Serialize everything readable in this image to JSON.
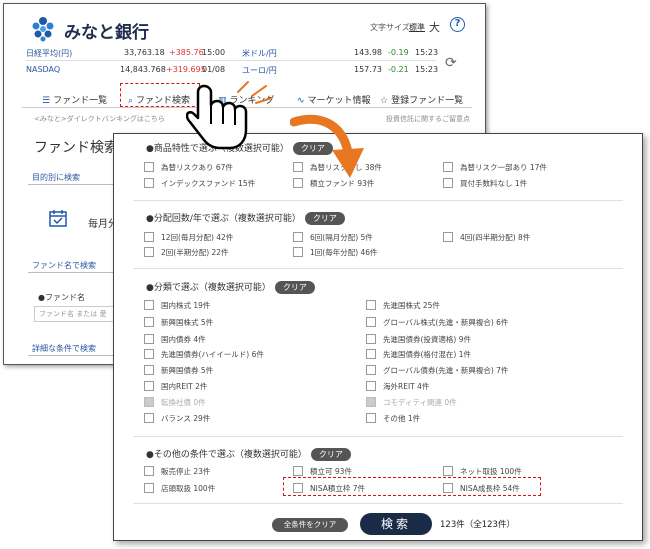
{
  "colors": {
    "brand": "#1f2d4e",
    "accent": "#1e5aa8",
    "positive": "#dd3333",
    "negative": "#2a8a2a",
    "highlight": "#dd1111",
    "arrow": "#e87722"
  },
  "header": {
    "logo_text": "みなと銀行",
    "font_size_label": "文字サイズ：",
    "font_size_standard": "標準",
    "font_size_large": "大",
    "help_icon": "?"
  },
  "market": [
    {
      "name": "日経平均(円)",
      "value": "33,763.18",
      "change": "+385.76",
      "time": "15:00"
    },
    {
      "name": "NASDAQ",
      "value": "14,843.768",
      "change": "+319.695",
      "time": "01/08"
    },
    {
      "name": "米ドル/円",
      "value": "143.98",
      "change": "-0.19",
      "time": "15:23"
    },
    {
      "name": "ユーロ/円",
      "value": "157.73",
      "change": "-0.21",
      "time": "15:23"
    }
  ],
  "nav": {
    "tabs": [
      "ファンド一覧",
      "ファンド検索",
      "ランキング",
      "マーケット情報",
      "登録ファンド一覧"
    ]
  },
  "breadcrumb": "<みなと>ダイレクトバンキングはこちら",
  "breadcrumb_right": "投資信託に関するご留意点",
  "page": {
    "title": "ファンド検索",
    "section_purpose": "目的別に検索",
    "monthly": "毎月分",
    "section_name": "ファンド名で検索",
    "fund_name_label": "●ファンド名",
    "fund_name_placeholder": "ファンド名 または 愛",
    "section_detail": "詳細な条件で検索"
  },
  "filters": {
    "clear_label": "クリア",
    "s1": {
      "title": "●商品特性で選ぶ（複数選択可能）",
      "items": [
        "為替リスクあり 67件",
        "為替リスクなし 38件",
        "為替リスク一部あり 17件",
        "インデックスファンド 15件",
        "積立ファンド 93件",
        "買付手数料なし 1件"
      ]
    },
    "s2": {
      "title": "●分配回数/年で選ぶ（複数選択可能）",
      "items": [
        "12回(毎月分配) 42件",
        "6回(隔月分配) 5件",
        "4回(四半期分配) 8件",
        "2回(半期分配) 22件",
        "1回(毎年分配) 46件"
      ]
    },
    "s3": {
      "title": "●分類で選ぶ（複数選択可能）",
      "left": [
        "国内株式 19件",
        "新興国株式 5件",
        "国内債券 4件",
        "先進国債券(ハイイールド) 6件",
        "新興国債券 5件",
        "国内REIT 2件",
        "転換社債 0件",
        "バランス 29件"
      ],
      "right": [
        "先進国株式 25件",
        "グローバル株式(先進・新興複合) 6件",
        "先進国債券(投資適格) 9件",
        "先進国債券(格付混在) 1件",
        "グローバル債券(先進・新興複合) 7件",
        "海外REIT 4件",
        "コモディティ関連 0件",
        "その他 1件"
      ]
    },
    "s4": {
      "title": "●その他の条件で選ぶ（複数選択可能）",
      "items": [
        "販売停止 23件",
        "積立可 93件",
        "ネット取扱 100件",
        "店頭取扱 100件",
        "NISA積立枠 7件",
        "NISA成長枠 54件"
      ]
    }
  },
  "footer": {
    "all_clear": "全条件をクリア",
    "search": "検索",
    "count": "123件（全123件）"
  }
}
